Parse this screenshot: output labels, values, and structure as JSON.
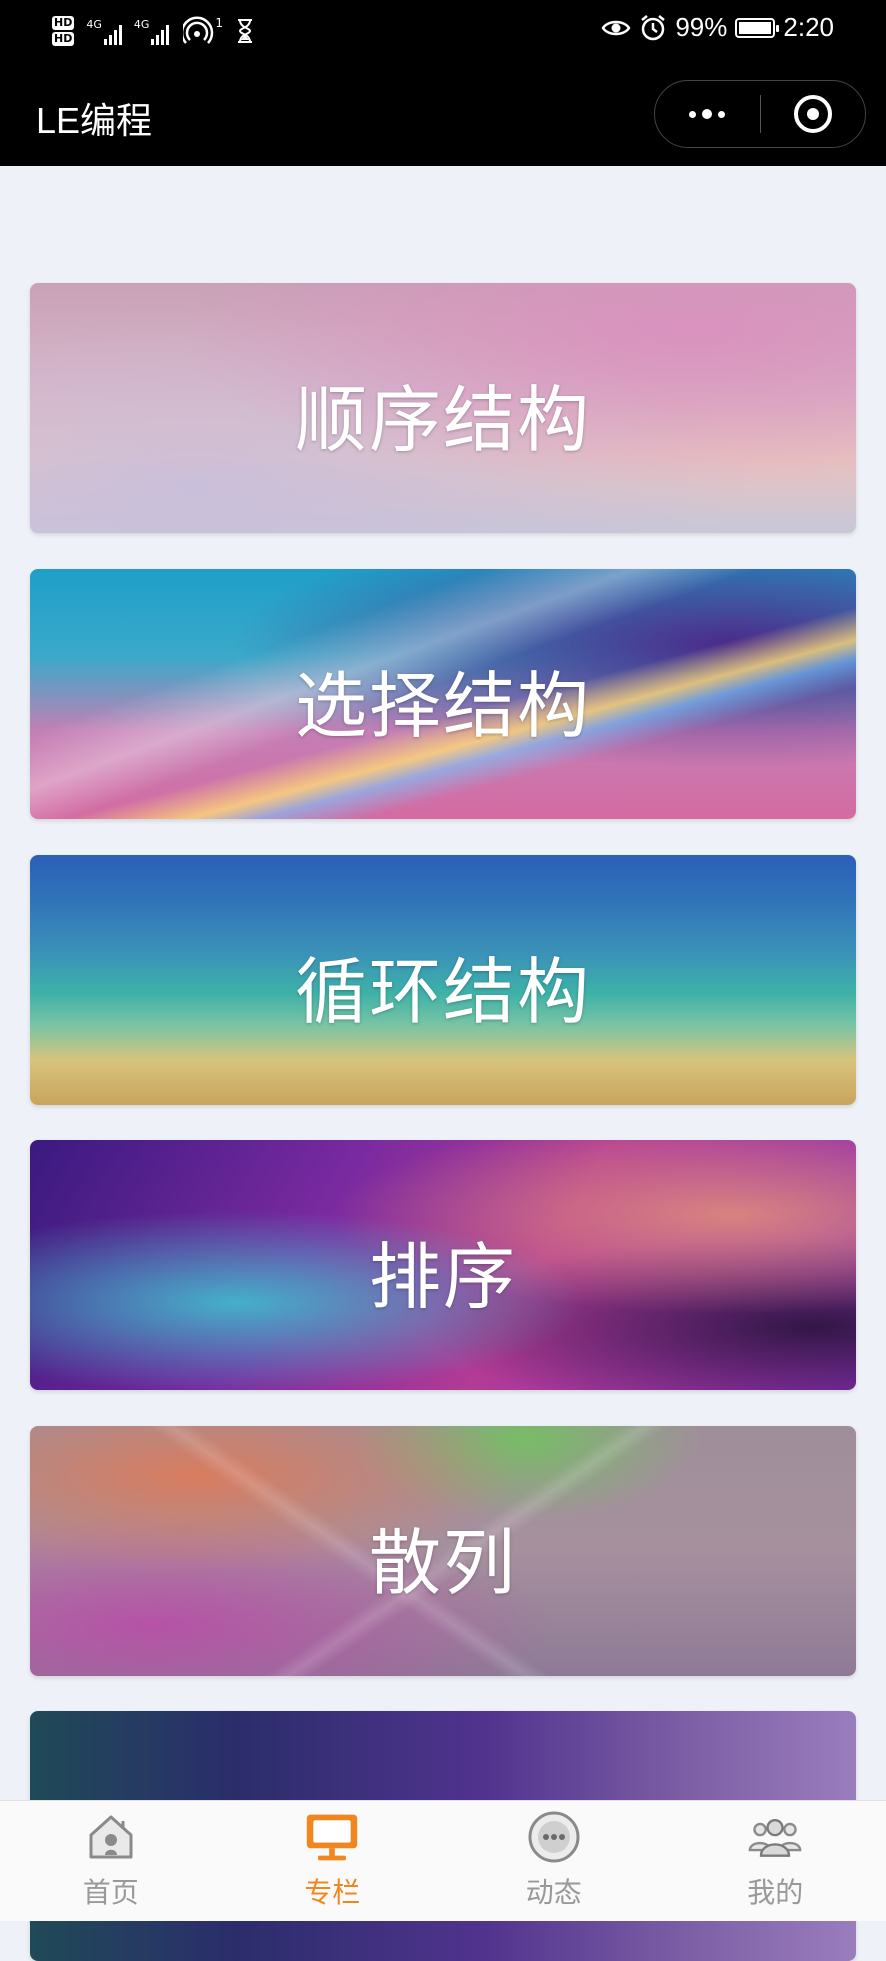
{
  "status_bar": {
    "hd1": "HD",
    "hd2": "HD",
    "net1": "4G",
    "net2": "4G",
    "hotspot_count": "1",
    "battery": "99%",
    "time": "2:20"
  },
  "nav": {
    "title": "LE编程"
  },
  "cards": [
    {
      "title": "顺序结构"
    },
    {
      "title": "选择结构"
    },
    {
      "title": "循环结构"
    },
    {
      "title": "排序"
    },
    {
      "title": "散列"
    },
    {
      "title": ""
    }
  ],
  "tabbar": {
    "active_color": "#f0861e",
    "inactive_color": "#999999",
    "tabs": [
      {
        "label": "首页",
        "icon": "home-icon"
      },
      {
        "label": "专栏",
        "icon": "monitor-icon"
      },
      {
        "label": "动态",
        "icon": "chat-dots-icon"
      },
      {
        "label": "我的",
        "icon": "users-icon"
      }
    ]
  }
}
